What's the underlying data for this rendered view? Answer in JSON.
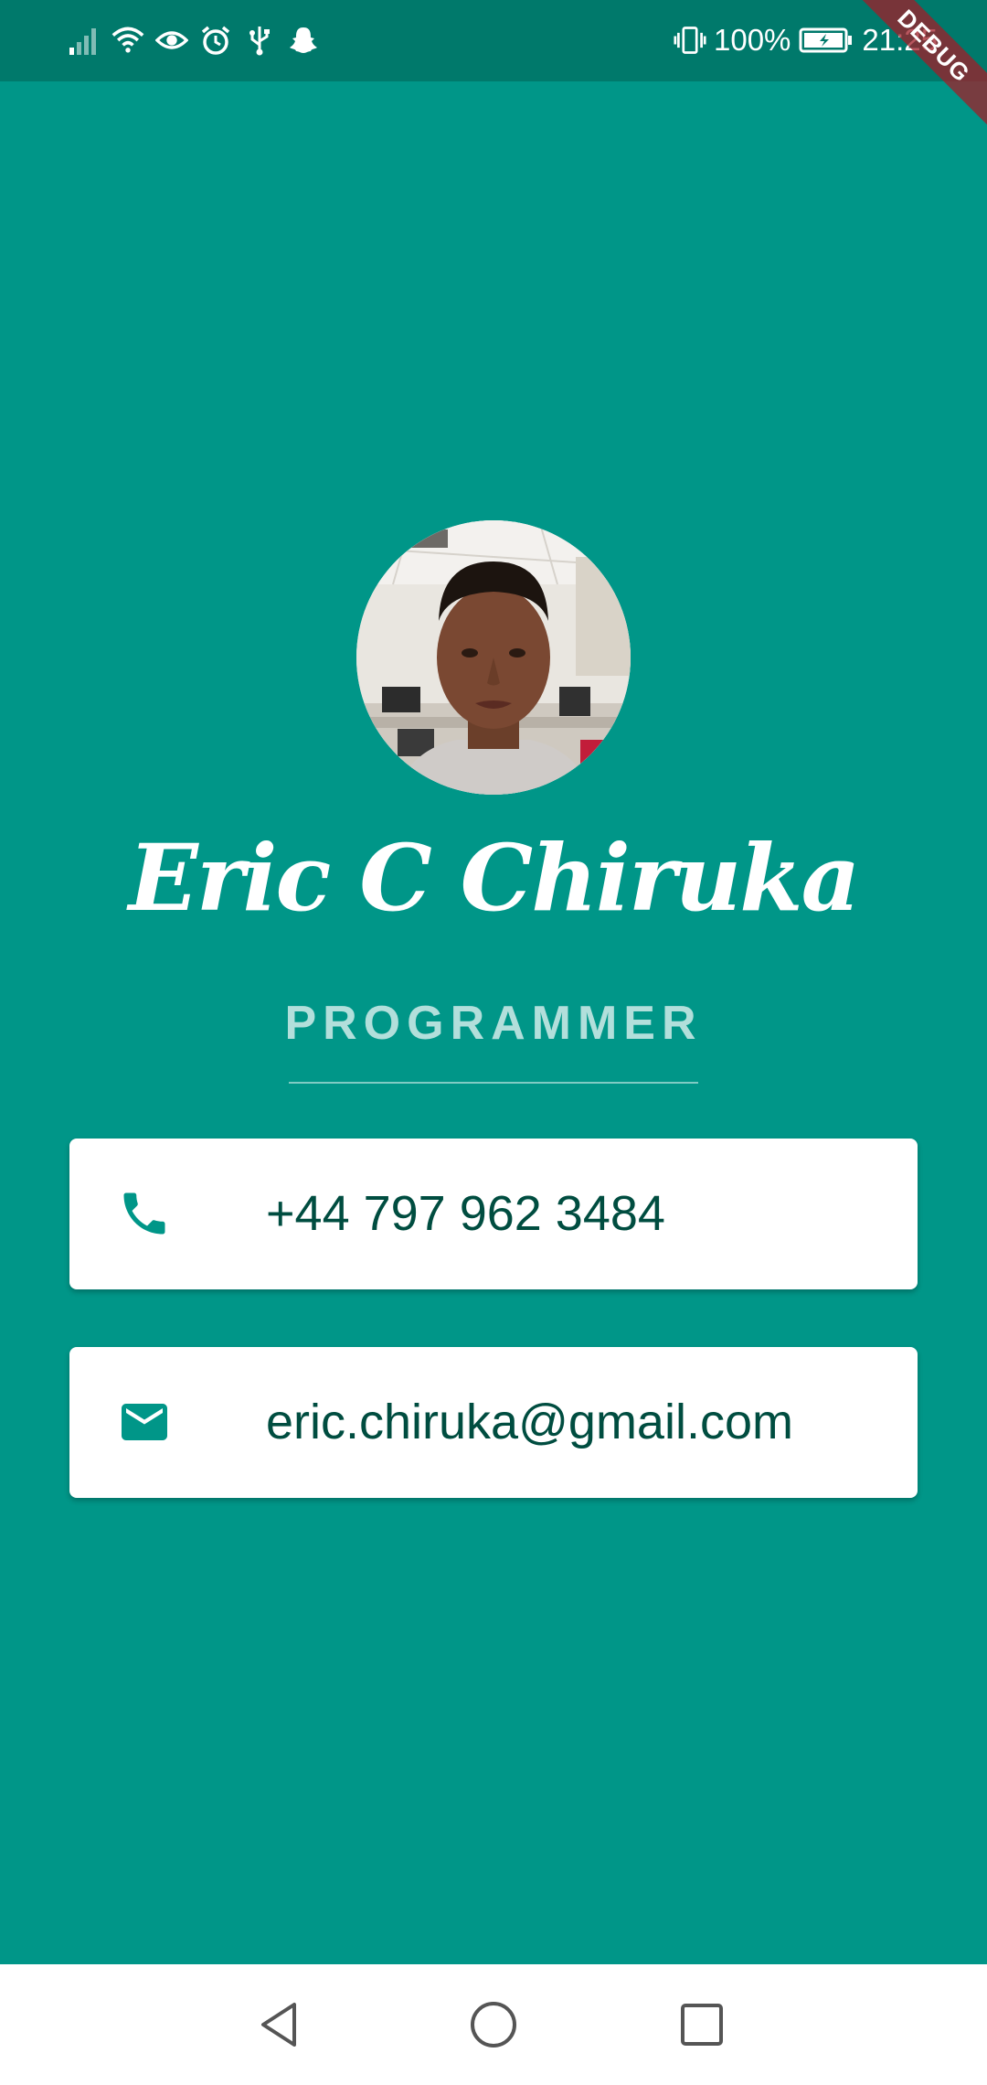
{
  "status_bar": {
    "battery_percent": "100%",
    "time": "21:25",
    "left_icons": [
      "signal-icon",
      "wifi-icon",
      "eye-icon",
      "alarm-icon",
      "usb-icon",
      "snapchat-icon"
    ],
    "right_icons": [
      "vibrate-icon",
      "battery-icon"
    ]
  },
  "debug_banner": "DEBUG",
  "profile": {
    "name": "Eric C Chiruka",
    "title": "PROGRAMMER"
  },
  "contacts": {
    "phone": {
      "icon": "phone-icon",
      "value": "+44 797 962 3484"
    },
    "email": {
      "icon": "email-icon",
      "value": "eric.chiruka@gmail.com"
    }
  },
  "nav_bar": {
    "icons": [
      "back-icon",
      "home-icon",
      "recents-icon"
    ]
  },
  "colors": {
    "background": "#009688",
    "status_bar": "#00796b",
    "card": "#ffffff",
    "card_text": "#004d40",
    "subtitle": "#b2dfdb"
  }
}
